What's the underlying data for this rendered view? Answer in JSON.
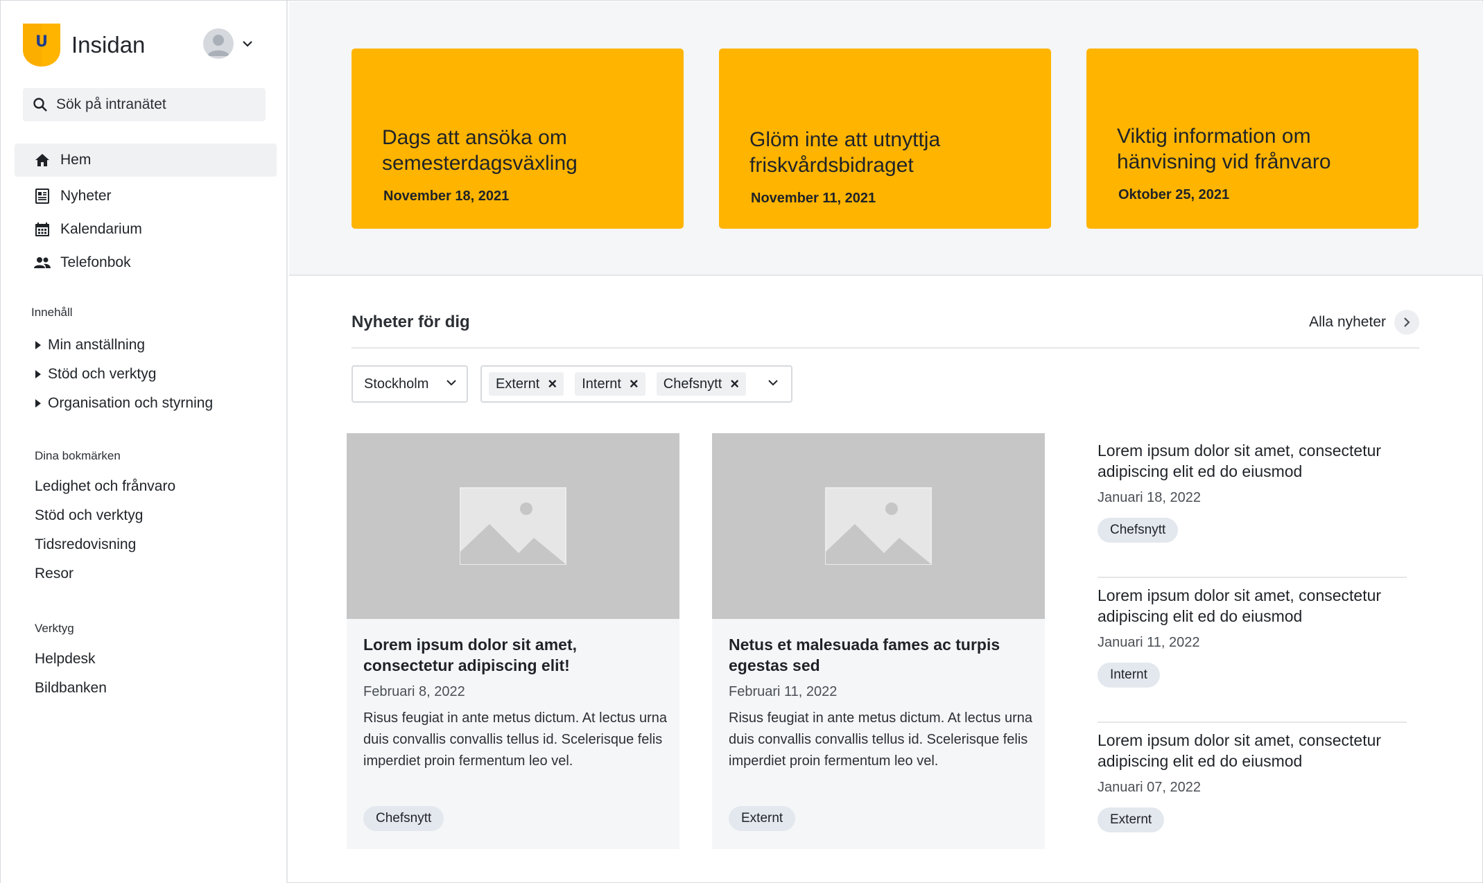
{
  "app": {
    "name": "Insidan",
    "logo_letter": "U"
  },
  "colors": {
    "accent": "#ffb400",
    "hero_bg": "#f5f6f8",
    "placeholder_img": "#c6c6c6",
    "tag_bg": "#e3e8ee"
  },
  "search": {
    "placeholder": "Sök på intranätet"
  },
  "nav": [
    {
      "label": "Hem",
      "icon": "home-icon",
      "active": true
    },
    {
      "label": "Nyheter",
      "icon": "newspaper-icon",
      "active": false
    },
    {
      "label": "Kalendarium",
      "icon": "calendar-icon",
      "active": false
    },
    {
      "label": "Telefonbok",
      "icon": "people-icon",
      "active": false
    }
  ],
  "content_section": {
    "title": "Innehåll",
    "items": [
      "Min anställning",
      "Stöd och verktyg",
      "Organisation och styrning"
    ]
  },
  "bookmarks": {
    "title": "Dina bokmärken",
    "items": [
      "Ledighet och frånvaro",
      "Stöd och verktyg",
      "Tidsredovisning",
      "Resor"
    ]
  },
  "tools": {
    "title": "Verktyg",
    "items": [
      "Helpdesk",
      "Bildbanken"
    ]
  },
  "hero_cards": [
    {
      "title": "Dags att ansöka om semesterdagsväxling",
      "date": "November 18, 2021"
    },
    {
      "title": "Glöm inte att utnyttja friskvårdsbidraget",
      "date": "November 11, 2021"
    },
    {
      "title": "Viktig information om hänvisning vid frånvaro",
      "date": "Oktober 25, 2021"
    }
  ],
  "news": {
    "title": "Nyheter för dig",
    "all_link": "Alla nyheter",
    "filter_city": "Stockholm",
    "filter_tags": [
      "Externt",
      "Internt",
      "Chefsnytt"
    ]
  },
  "cards": [
    {
      "title": "Lorem ipsum dolor sit amet, consectetur adipiscing elit!",
      "date": "Februari  8, 2022",
      "excerpt": "Risus feugiat in ante metus dictum. At lectus urna duis convallis convallis tellus id. Scelerisque felis imperdiet proin fermentum leo vel.",
      "tag": "Chefsnytt"
    },
    {
      "title": "Netus et malesuada fames ac turpis egestas sed",
      "date": "Februari 11, 2022",
      "excerpt": "Risus feugiat in ante metus dictum. At lectus urna duis convallis convallis tellus id. Scelerisque felis imperdiet proin fermentum leo vel.",
      "tag": "Externt"
    }
  ],
  "side_news": [
    {
      "title": "Lorem ipsum dolor sit amet, consectetur adipiscing elit ed do eiusmod",
      "date": "Januari 18, 2022",
      "tag": "Chefsnytt"
    },
    {
      "title": "Lorem ipsum dolor sit amet, consectetur adipiscing elit ed do eiusmod",
      "date": "Januari 11, 2022",
      "tag": "Internt"
    },
    {
      "title": "Lorem ipsum dolor sit amet, consectetur adipiscing elit ed do eiusmod",
      "date": "Januari 07, 2022",
      "tag": "Externt"
    }
  ]
}
